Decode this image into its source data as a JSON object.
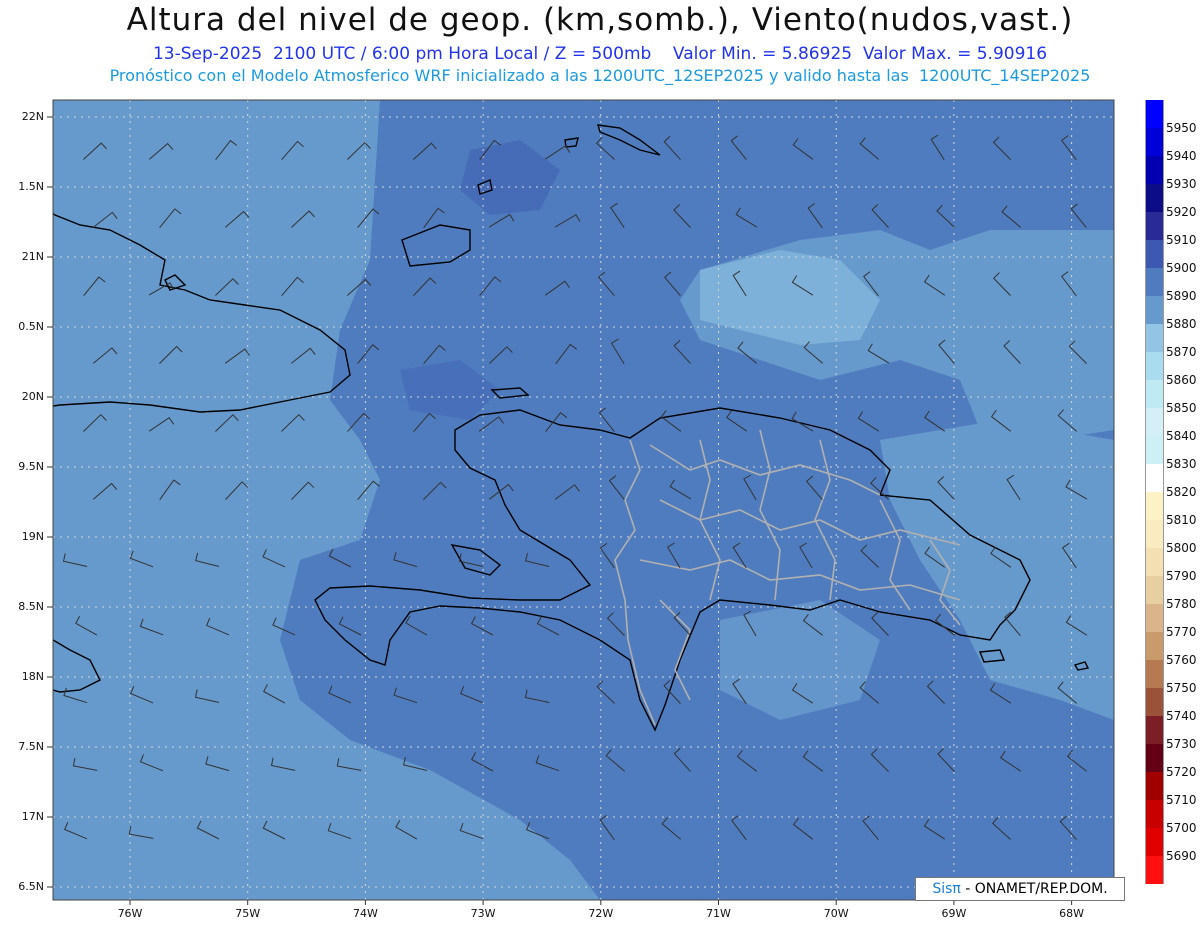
{
  "header": {
    "title": "Altura del nivel de geop. (km,somb.), Viento(nudos,vast.)",
    "subtitle": "13-Sep-2025  2100 UTC / 6:00 pm Hora Local / Z = 500mb    Valor Min. = 5.86925  Valor Max. = 5.90916",
    "forecast_info": "Pronóstico con el Modelo Atmosferico WRF inicializado a las 1200UTC_12SEP2025 y valido hasta las  1200UTC_14SEP2025"
  },
  "axes": {
    "lat_labels": [
      "22N",
      "1.5N",
      "21N",
      "0.5N",
      "20N",
      "9.5N",
      "19N",
      "8.5N",
      "18N",
      "7.5N",
      "17N",
      "6.5N"
    ],
    "lon_labels": [
      "76W",
      "75W",
      "74W",
      "73W",
      "72W",
      "71W",
      "70W",
      "69W",
      "68W"
    ]
  },
  "colorbar": {
    "levels": [
      {
        "label": "5950",
        "color": "#0000ff"
      },
      {
        "label": "5940",
        "color": "#0000d8"
      },
      {
        "label": "5930",
        "color": "#0000b0"
      },
      {
        "label": "5920",
        "color": "#0c0c86"
      },
      {
        "label": "5910",
        "color": "#2a2a96"
      },
      {
        "label": "5900",
        "color": "#3c58b0"
      },
      {
        "label": "5890",
        "color": "#4f7cbf"
      },
      {
        "label": "5880",
        "color": "#6699cc"
      },
      {
        "label": "5870",
        "color": "#92c4e4"
      },
      {
        "label": "5860",
        "color": "#a8dcee"
      },
      {
        "label": "5850",
        "color": "#bfe9f3"
      },
      {
        "label": "5840",
        "color": "#d4f0f7"
      },
      {
        "label": "5830",
        "color": "#ccf0f5"
      },
      {
        "label": "5820",
        "color": "#ffffff"
      },
      {
        "label": "5810",
        "color": "#fcf2c6"
      },
      {
        "label": "5800",
        "color": "#f8ecc0"
      },
      {
        "label": "5790",
        "color": "#f2e0b2"
      },
      {
        "label": "5780",
        "color": "#e8cfa0"
      },
      {
        "label": "5770",
        "color": "#dab58a"
      },
      {
        "label": "5760",
        "color": "#c99a6a"
      },
      {
        "label": "5750",
        "color": "#b57a52"
      },
      {
        "label": "5740",
        "color": "#9a5238"
      },
      {
        "label": "5730",
        "color": "#7c1e26"
      },
      {
        "label": "5720",
        "color": "#640016"
      },
      {
        "label": "5710",
        "color": "#a00000"
      },
      {
        "label": "5700",
        "color": "#c80000"
      },
      {
        "label": "5690",
        "color": "#e00000"
      },
      {
        "label": "",
        "color": "#ff1010"
      }
    ]
  },
  "credit": {
    "brand": "Sisπ",
    "text": " - ONAMET/REP.DOM."
  },
  "colors": {
    "background_field": "#6699cc",
    "mid_field": "#4f7cbf",
    "light_field": "#92c4e4",
    "coastline": "#000000",
    "provinces": "#b0b0b0",
    "gridline": "#d8d8d8",
    "wind_barb": "#333333"
  }
}
